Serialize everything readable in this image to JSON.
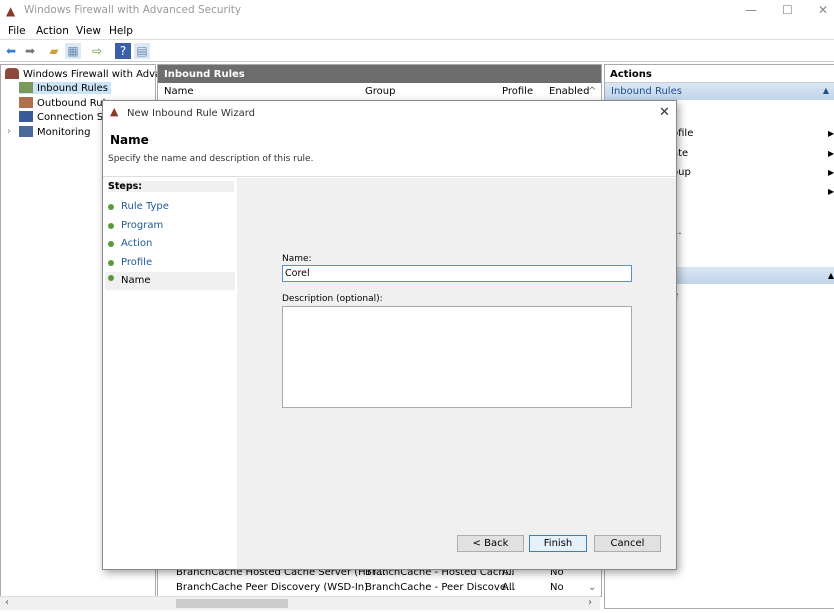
{
  "window": {
    "title": "Windows Firewall with Advanced Security"
  },
  "menu": [
    "File",
    "Action",
    "View",
    "Help"
  ],
  "tree": {
    "root": "Windows Firewall with Advance",
    "items": [
      "Inbound Rules",
      "Outbound Rule",
      "Connection Sec",
      "Monitoring"
    ]
  },
  "middle": {
    "title": "Inbound Rules",
    "columns": [
      "Name",
      "Group",
      "Profile",
      "Enabled"
    ],
    "rows": [
      [
        "BranchCache Hosted Cache Server (HTT...",
        "BranchCache - Hosted Cach...",
        "All",
        "No"
      ],
      [
        "BranchCache Peer Discovery (WSD-In)",
        "BranchCache - Peer Discove...",
        "All",
        "No"
      ]
    ]
  },
  "actions": {
    "title": "Actions",
    "section": "Inbound Rules",
    "items": [
      "ofile",
      "ate",
      "oup",
      "...",
      "e"
    ]
  },
  "wizard": {
    "title": "New Inbound Rule Wizard",
    "heading": "Name",
    "subtitle": "Specify the name and description of this rule.",
    "steps_label": "Steps:",
    "steps": [
      "Rule Type",
      "Program",
      "Action",
      "Profile",
      "Name"
    ],
    "current_step": "Name",
    "name_label": "Name:",
    "name_value": "Corel ",
    "description_label": "Description (optional):",
    "description_value": "",
    "back": "< Back",
    "finish": "Finish",
    "cancel": "Cancel"
  }
}
